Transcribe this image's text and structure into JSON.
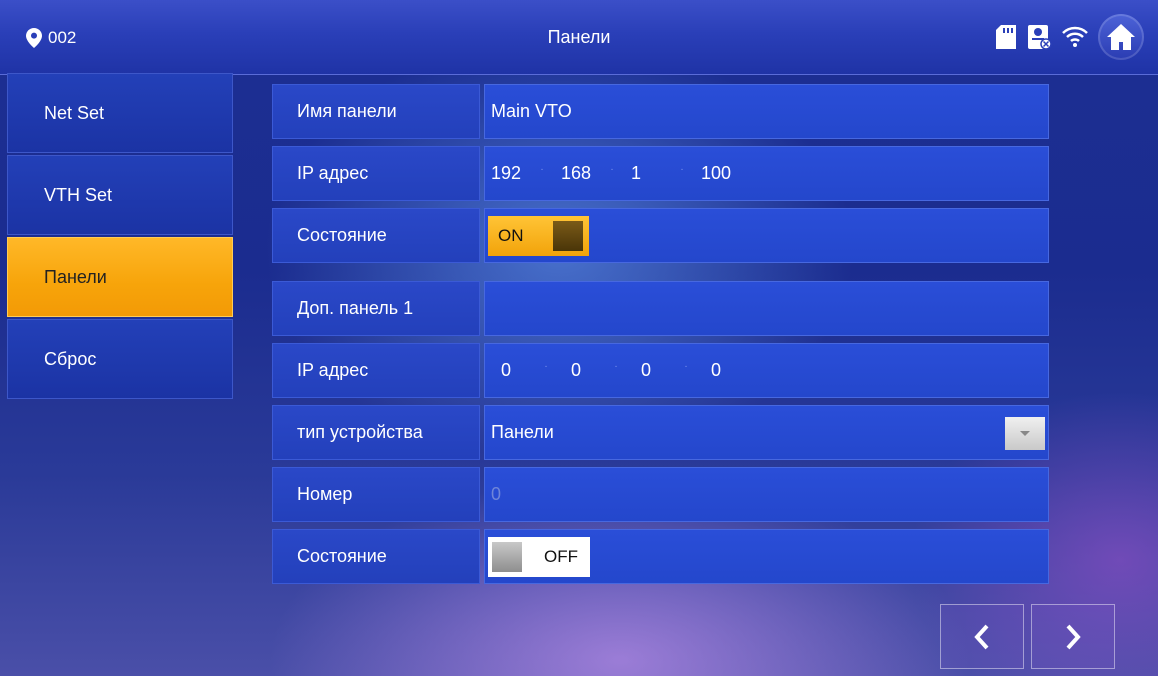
{
  "header": {
    "location": "002",
    "title": "Панели",
    "icons": [
      "location-pin-icon",
      "sd-card-icon",
      "intercom-status-icon",
      "wifi-icon",
      "home-icon"
    ]
  },
  "sidebar": {
    "items": [
      {
        "label": "Net Set"
      },
      {
        "label": "VTH Set"
      },
      {
        "label": "Панели",
        "active": true
      },
      {
        "label": "Сброс"
      }
    ]
  },
  "form": {
    "main_panel": {
      "name_label": "Имя панели",
      "name_value": "Main VTO",
      "ip_label": "IP адрес",
      "ip": [
        "192",
        "168",
        "1",
        "100"
      ],
      "state_label": "Состояние",
      "state_value": "ON"
    },
    "extra_panel": {
      "name_label": "Доп. панель 1",
      "name_value": "",
      "ip_label": "IP адрес",
      "ip": [
        "0",
        "0",
        "0",
        "0"
      ],
      "type_label": "тип устройства",
      "type_value": "Панели",
      "number_label": "Номер",
      "number_placeholder": "0",
      "state_label": "Состояние",
      "state_value": "OFF"
    }
  },
  "colors": {
    "accent": "#f7a40a",
    "background": "#1c2f93"
  },
  "nav": {
    "prev_icon": "chevron-left-icon",
    "next_icon": "chevron-right-icon"
  }
}
